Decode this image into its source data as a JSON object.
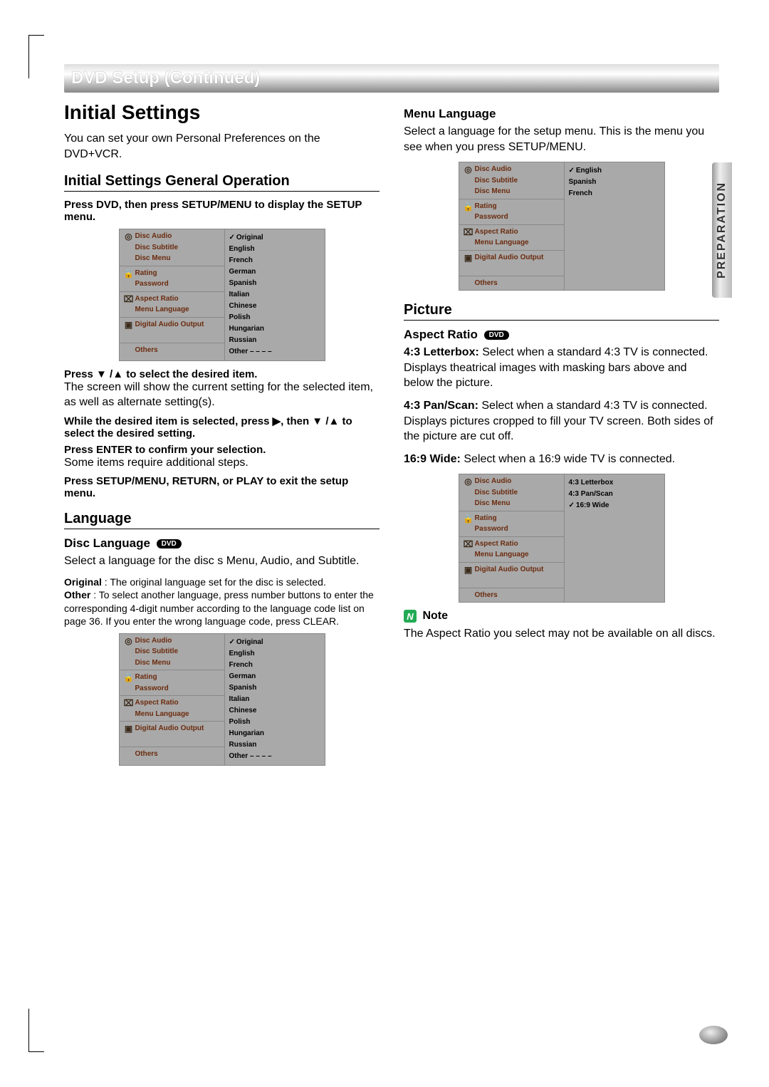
{
  "banner": "DVD Setup (Continued)",
  "side_tab": "PREPARATION",
  "left": {
    "title": "Initial Settings",
    "intro": "You can set your own Personal Preferences on the DVD+VCR.",
    "sub1": "Initial Settings General Operation",
    "step1": "Press DVD, then press SETUP/MENU to display the SETUP menu.",
    "step2": "Press ▼ /▲ to select the desired item.",
    "step2b": "The screen will show the current setting for the selected item, as well as alternate setting(s).",
    "step3": "While the desired item is selected, press ▶, then ▼ /▲ to select the desired setting.",
    "step4": "Press ENTER to confirm your selection.",
    "step4b": "Some items require additional steps.",
    "step5": "Press SETUP/MENU, RETURN, or PLAY to exit the setup menu.",
    "lang_h": "Language",
    "disc_lang_h": "Disc Language",
    "disc_lang_p": "Select a language for the disc s Menu, Audio, and Subtitle.",
    "orig_b": "Original",
    "orig_t": " : The original language set for the disc is selected.",
    "other_b": "Other",
    "other_t": " : To select another language, press number buttons to enter the corresponding 4-digit number according to the language code list on page 36. If you enter the wrong language code, press CLEAR."
  },
  "right": {
    "menu_h": "Menu Language",
    "menu_p": "Select a language for the setup menu. This is the menu you see when you press SETUP/MENU.",
    "pic_h": "Picture",
    "aspect_h": "Aspect Ratio",
    "ar1b": "4:3 Letterbox:",
    "ar1": " Select when a standard 4:3 TV is connected. Displays theatrical images with masking bars above and below the picture.",
    "ar2b": "4:3 Pan/Scan:",
    "ar2": " Select when a standard 4:3 TV is connected. Displays pictures cropped to fill your TV screen. Both sides of the picture are cut off.",
    "ar3b": "16:9 Wide:",
    "ar3": " Select when a 16:9 wide TV is connected.",
    "note_h": "Note",
    "note_p": "The Aspect Ratio you select may not be available on all discs."
  },
  "dvd_pill": "DVD",
  "osd_labels": {
    "g1a": "Disc Audio",
    "g1b": "Disc Subtitle",
    "g1c": "Disc Menu",
    "g2a": "Rating",
    "g2b": "Password",
    "g3a": "Aspect Ratio",
    "g3b": "Menu Language",
    "g4a": "Digital Audio Output",
    "g5a": "Others"
  },
  "osd_lang_opts": {
    "o0": "Original",
    "o1": "English",
    "o2": "French",
    "o3": "German",
    "o4": "Spanish",
    "o5": "Italian",
    "o6": "Chinese",
    "o7": "Polish",
    "o8": "Hungarian",
    "o9": "Russian",
    "o10": "Other  – – – –"
  },
  "osd_menu_opts": {
    "m0": "English",
    "m1": "Spanish",
    "m2": "French"
  },
  "osd_ar_opts": {
    "a0": "4:3 Letterbox",
    "a1": "4:3 Pan/Scan",
    "a2": "16:9 Wide"
  }
}
